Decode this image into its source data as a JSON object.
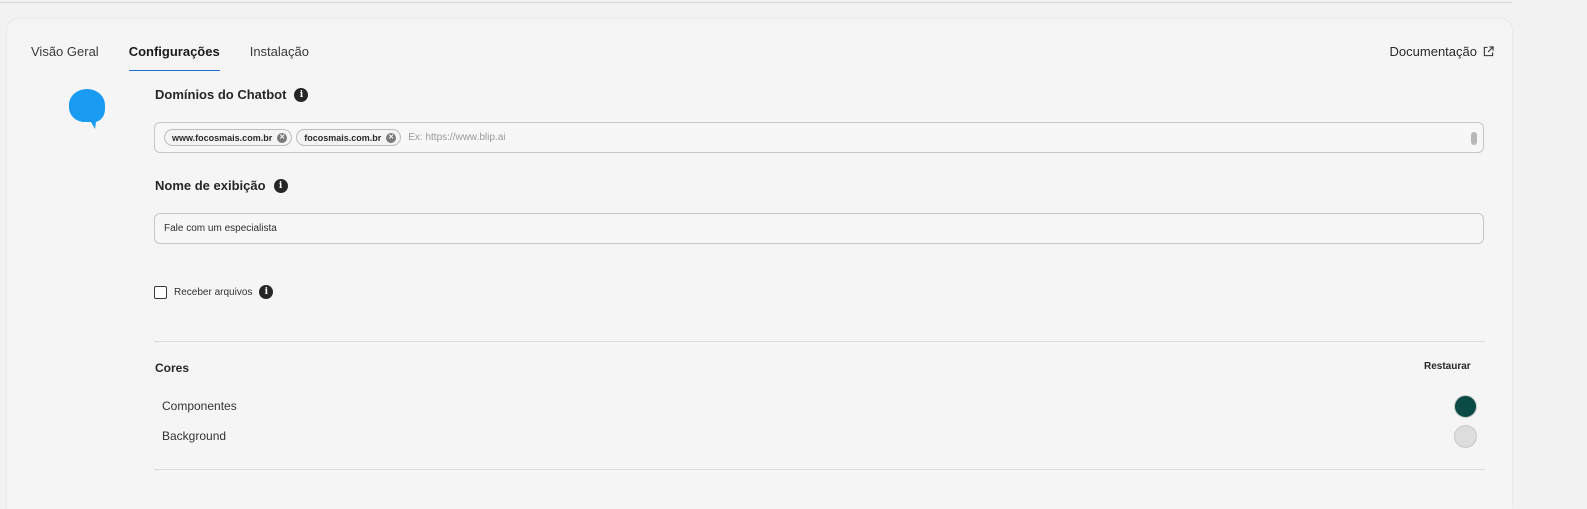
{
  "tabs": [
    {
      "label": "Visão Geral",
      "active": false
    },
    {
      "label": "Configurações",
      "active": true
    },
    {
      "label": "Instalação",
      "active": false
    }
  ],
  "docs_link": "Documentação",
  "domains": {
    "label": "Domínios do Chatbot",
    "chips": [
      "www.focosmais.com.br",
      "focosmais.com.br"
    ],
    "placeholder": "Ex: https://www.blip.ai"
  },
  "display_name": {
    "label": "Nome de exibição",
    "value": "Fale com um especialista"
  },
  "receive_files": {
    "label": "Receber arquivos",
    "checked": false
  },
  "colors": {
    "title": "Cores",
    "restore_label": "Restaurar",
    "items": [
      {
        "label": "Componentes",
        "color": "#0b4a45"
      },
      {
        "label": "Background",
        "color": "#dddddd"
      }
    ]
  },
  "bubble_color": "#1a9bf2"
}
